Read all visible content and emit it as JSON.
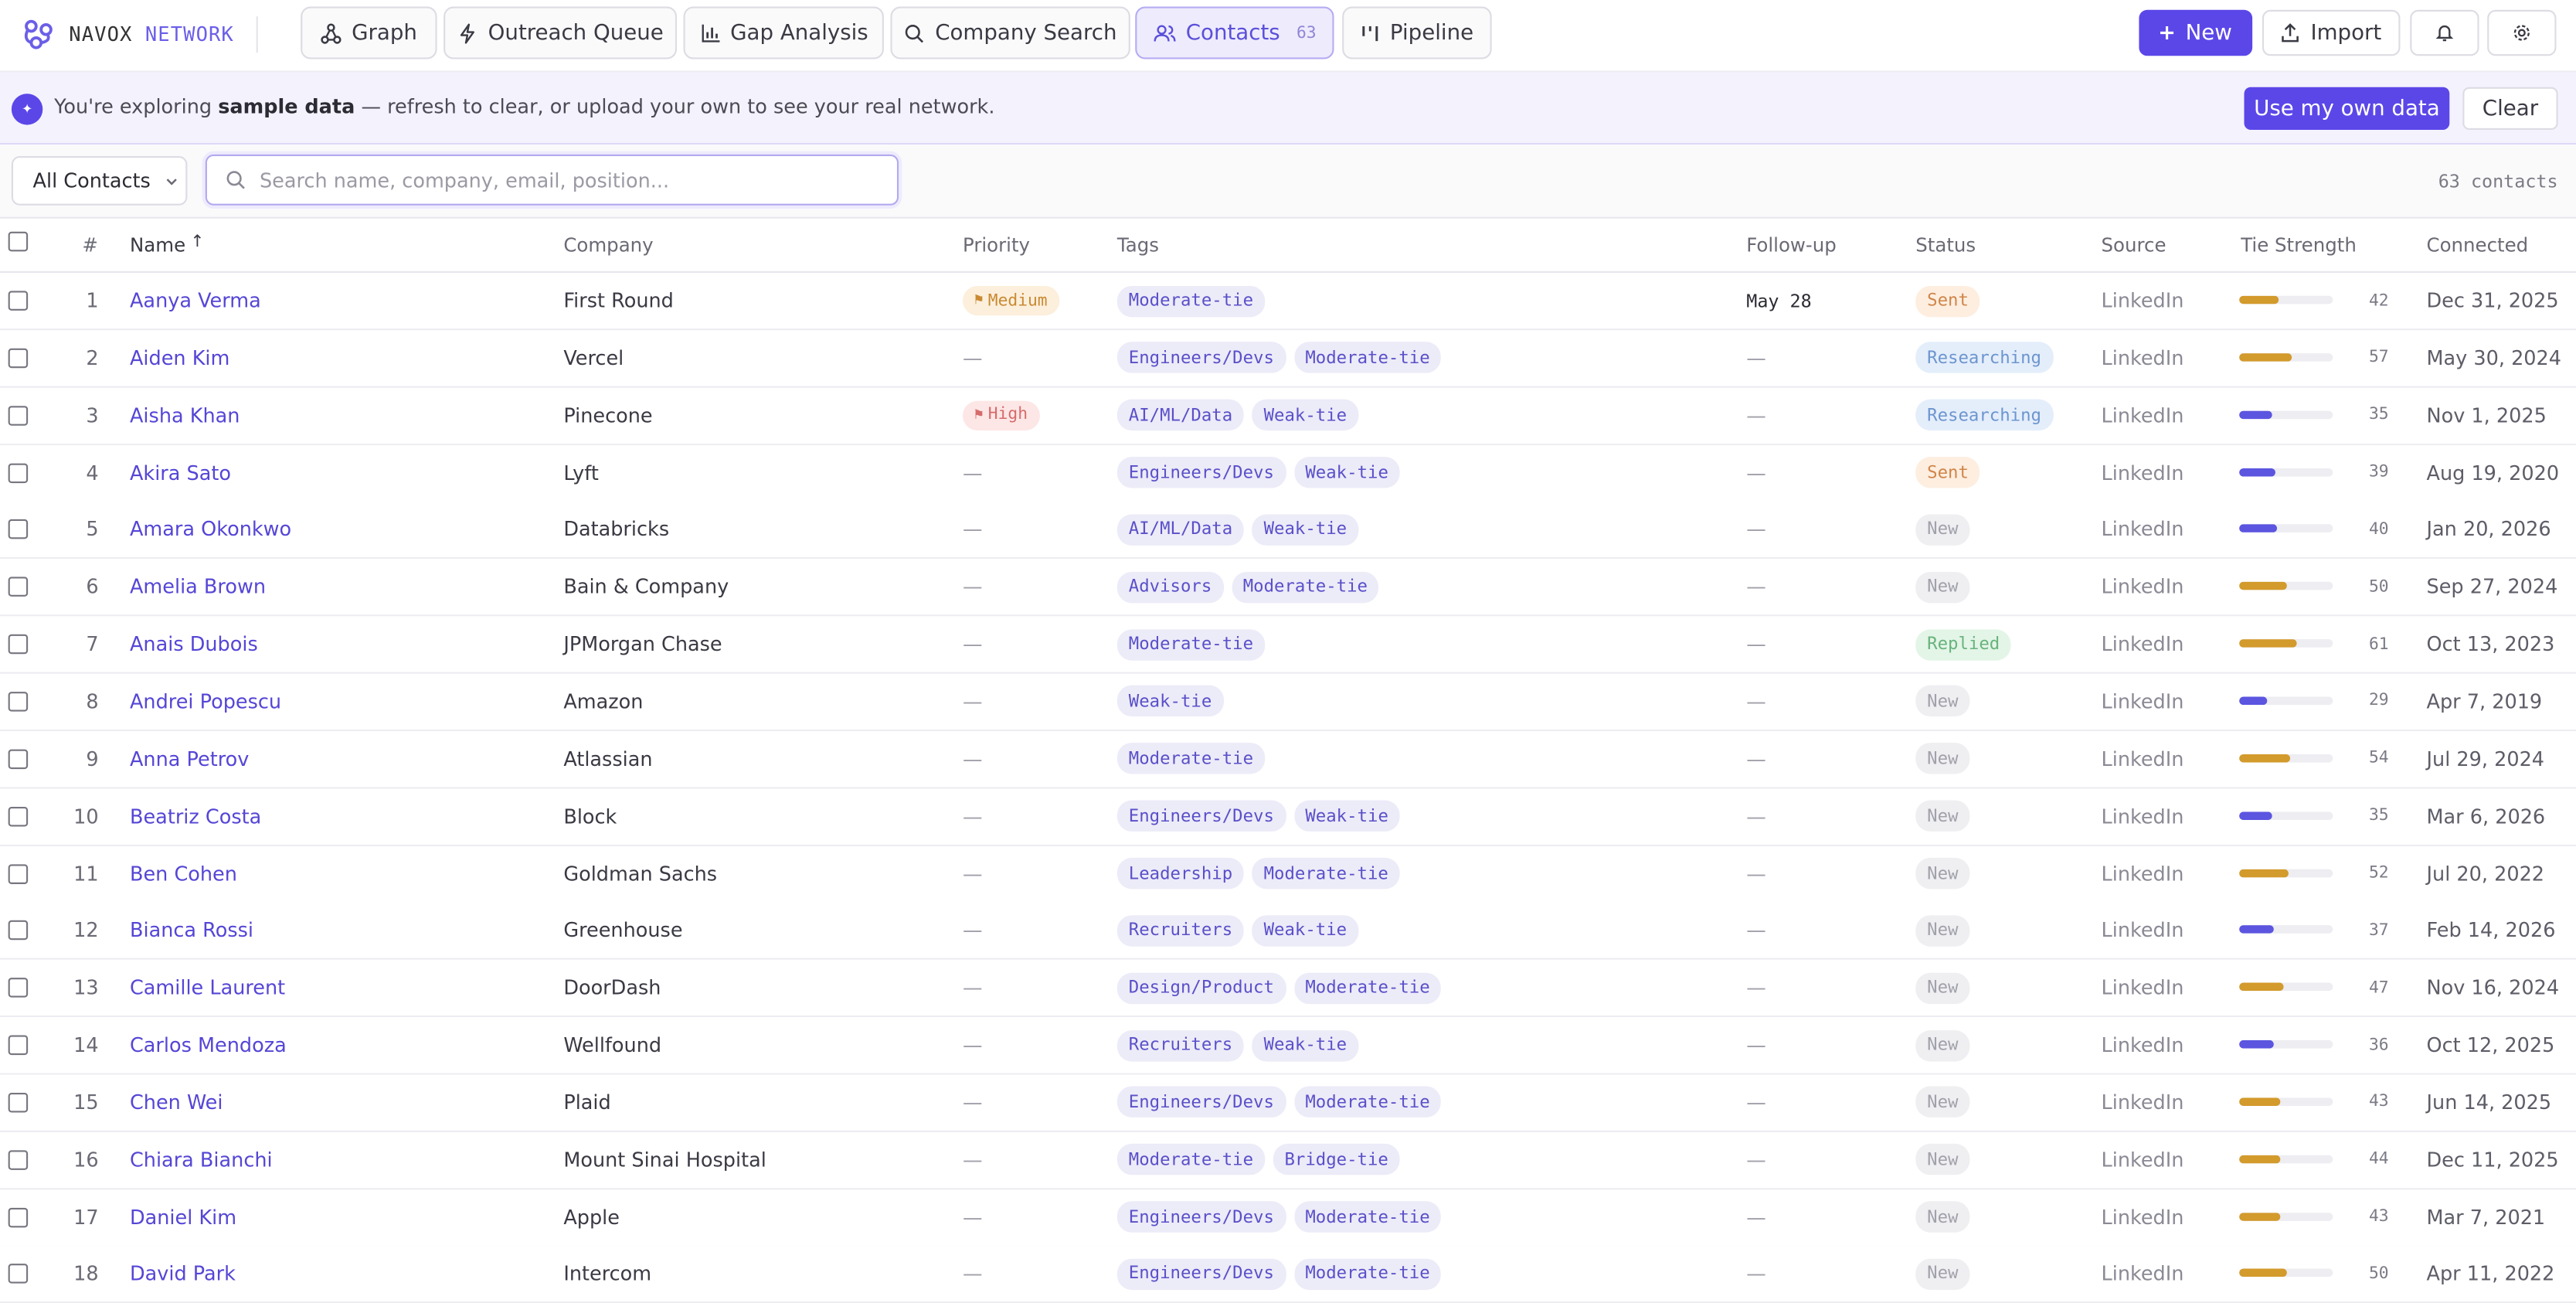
{
  "app": {
    "brand_primary": "NAVOX",
    "brand_secondary": "NETWORK",
    "accent_color": "#5b47e8"
  },
  "nav": {
    "tabs": [
      {
        "label": "Graph",
        "icon": "graph-icon"
      },
      {
        "label": "Outreach Queue",
        "icon": "bolt-icon"
      },
      {
        "label": "Gap Analysis",
        "icon": "bar-chart-icon"
      },
      {
        "label": "Company Search",
        "icon": "search-icon"
      },
      {
        "label": "Contacts",
        "icon": "users-icon",
        "count": "63",
        "active": true
      },
      {
        "label": "Pipeline",
        "icon": "pipeline-icon"
      }
    ],
    "new_label": "New",
    "import_label": "Import"
  },
  "banner": {
    "prefix": "You're exploring ",
    "bold": "sample data",
    "suffix": " — refresh to clear, or upload your own to see your real network.",
    "primary_action": "Use my own data",
    "secondary_action": "Clear"
  },
  "filters": {
    "view_select": "All Contacts",
    "search_placeholder": "Search name, company, email, position...",
    "count_label": "63 contacts"
  },
  "table": {
    "columns": {
      "index": "#",
      "name": "Name",
      "company": "Company",
      "priority": "Priority",
      "tags": "Tags",
      "followup": "Follow-up",
      "status": "Status",
      "source": "Source",
      "tie": "Tie Strength",
      "connected": "Connected"
    },
    "sort_indicator": "↑",
    "rows": [
      {
        "idx": "1",
        "name": "Aanya Verma",
        "company": "First Round",
        "priority": "Medium",
        "tags": [
          "Moderate-tie"
        ],
        "followup": "May 28",
        "status": "Sent",
        "source": "LinkedIn",
        "tie": 42,
        "connected": "Dec 31, 2025"
      },
      {
        "idx": "2",
        "name": "Aiden Kim",
        "company": "Vercel",
        "priority": "—",
        "tags": [
          "Engineers/Devs",
          "Moderate-tie"
        ],
        "followup": "—",
        "status": "Researching",
        "source": "LinkedIn",
        "tie": 57,
        "connected": "May 30, 2024"
      },
      {
        "idx": "3",
        "name": "Aisha Khan",
        "company": "Pinecone",
        "priority": "High",
        "tags": [
          "AI/ML/Data",
          "Weak-tie"
        ],
        "followup": "—",
        "status": "Researching",
        "source": "LinkedIn",
        "tie": 35,
        "connected": "Nov 1, 2025"
      },
      {
        "idx": "4",
        "name": "Akira Sato",
        "company": "Lyft",
        "priority": "—",
        "tags": [
          "Engineers/Devs",
          "Weak-tie"
        ],
        "followup": "—",
        "status": "Sent",
        "source": "LinkedIn",
        "tie": 39,
        "connected": "Aug 19, 2020"
      },
      {
        "idx": "5",
        "name": "Amara Okonkwo",
        "company": "Databricks",
        "priority": "—",
        "tags": [
          "AI/ML/Data",
          "Weak-tie"
        ],
        "followup": "—",
        "status": "New",
        "source": "LinkedIn",
        "tie": 40,
        "connected": "Jan 20, 2026"
      },
      {
        "idx": "6",
        "name": "Amelia Brown",
        "company": "Bain & Company",
        "priority": "—",
        "tags": [
          "Advisors",
          "Moderate-tie"
        ],
        "followup": "—",
        "status": "New",
        "source": "LinkedIn",
        "tie": 50,
        "connected": "Sep 27, 2024"
      },
      {
        "idx": "7",
        "name": "Anais Dubois",
        "company": "JPMorgan Chase",
        "priority": "—",
        "tags": [
          "Moderate-tie"
        ],
        "followup": "—",
        "status": "Replied",
        "source": "LinkedIn",
        "tie": 61,
        "connected": "Oct 13, 2023"
      },
      {
        "idx": "8",
        "name": "Andrei Popescu",
        "company": "Amazon",
        "priority": "—",
        "tags": [
          "Weak-tie"
        ],
        "followup": "—",
        "status": "New",
        "source": "LinkedIn",
        "tie": 29,
        "connected": "Apr 7, 2019"
      },
      {
        "idx": "9",
        "name": "Anna Petrov",
        "company": "Atlassian",
        "priority": "—",
        "tags": [
          "Moderate-tie"
        ],
        "followup": "—",
        "status": "New",
        "source": "LinkedIn",
        "tie": 54,
        "connected": "Jul 29, 2024"
      },
      {
        "idx": "10",
        "name": "Beatriz Costa",
        "company": "Block",
        "priority": "—",
        "tags": [
          "Engineers/Devs",
          "Weak-tie"
        ],
        "followup": "—",
        "status": "New",
        "source": "LinkedIn",
        "tie": 35,
        "connected": "Mar 6, 2026"
      },
      {
        "idx": "11",
        "name": "Ben Cohen",
        "company": "Goldman Sachs",
        "priority": "—",
        "tags": [
          "Leadership",
          "Moderate-tie"
        ],
        "followup": "—",
        "status": "New",
        "source": "LinkedIn",
        "tie": 52,
        "connected": "Jul 20, 2022"
      },
      {
        "idx": "12",
        "name": "Bianca Rossi",
        "company": "Greenhouse",
        "priority": "—",
        "tags": [
          "Recruiters",
          "Weak-tie"
        ],
        "followup": "—",
        "status": "New",
        "source": "LinkedIn",
        "tie": 37,
        "connected": "Feb 14, 2026"
      },
      {
        "idx": "13",
        "name": "Camille Laurent",
        "company": "DoorDash",
        "priority": "—",
        "tags": [
          "Design/Product",
          "Moderate-tie"
        ],
        "followup": "—",
        "status": "New",
        "source": "LinkedIn",
        "tie": 47,
        "connected": "Nov 16, 2024"
      },
      {
        "idx": "14",
        "name": "Carlos Mendoza",
        "company": "Wellfound",
        "priority": "—",
        "tags": [
          "Recruiters",
          "Weak-tie"
        ],
        "followup": "—",
        "status": "New",
        "source": "LinkedIn",
        "tie": 36,
        "connected": "Oct 12, 2025"
      },
      {
        "idx": "15",
        "name": "Chen Wei",
        "company": "Plaid",
        "priority": "—",
        "tags": [
          "Engineers/Devs",
          "Moderate-tie"
        ],
        "followup": "—",
        "status": "New",
        "source": "LinkedIn",
        "tie": 43,
        "connected": "Jun 14, 2025"
      },
      {
        "idx": "16",
        "name": "Chiara Bianchi",
        "company": "Mount Sinai Hospital",
        "priority": "—",
        "tags": [
          "Moderate-tie",
          "Bridge-tie"
        ],
        "followup": "—",
        "status": "New",
        "source": "LinkedIn",
        "tie": 44,
        "connected": "Dec 11, 2025"
      },
      {
        "idx": "17",
        "name": "Daniel Kim",
        "company": "Apple",
        "priority": "—",
        "tags": [
          "Engineers/Devs",
          "Moderate-tie"
        ],
        "followup": "—",
        "status": "New",
        "source": "LinkedIn",
        "tie": 43,
        "connected": "Mar 7, 2021"
      },
      {
        "idx": "18",
        "name": "David Park",
        "company": "Intercom",
        "priority": "—",
        "tags": [
          "Engineers/Devs",
          "Moderate-tie"
        ],
        "followup": "—",
        "status": "New",
        "source": "LinkedIn",
        "tie": 50,
        "connected": "Apr 11, 2022"
      }
    ]
  },
  "tie_colors": {
    "weak": "#5b55e0",
    "moderate": "#d39a2c"
  }
}
